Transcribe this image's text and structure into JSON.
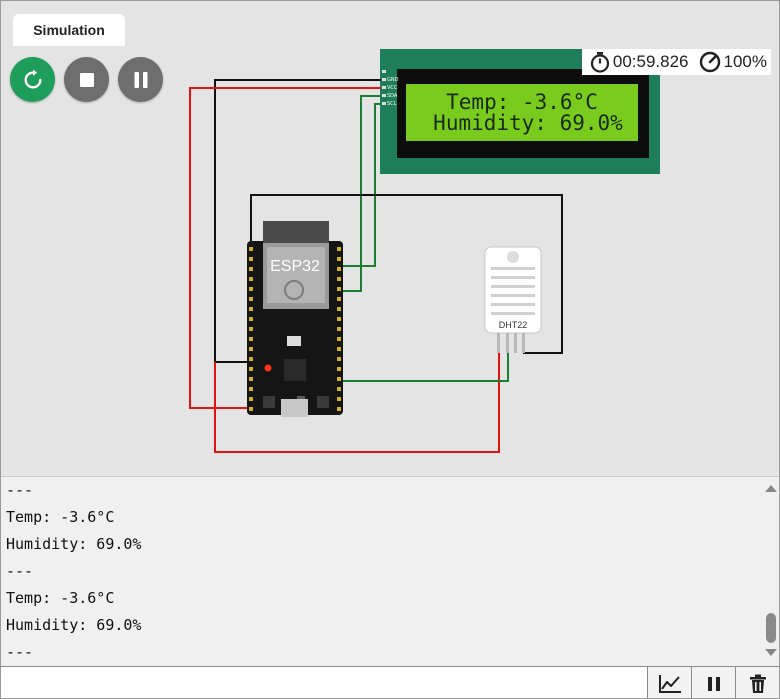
{
  "tab": {
    "label": "Simulation"
  },
  "controls": {
    "restart": {
      "icon": "restart-icon"
    },
    "stop": {
      "icon": "stop-icon"
    },
    "pause": {
      "icon": "pause-icon"
    }
  },
  "status": {
    "timer": "00:59.826",
    "speed": "100%"
  },
  "lcd": {
    "line1": "Temp: -3.6°C",
    "line2": "Humidity: 69.0%",
    "pins": [
      "GND",
      "VCC",
      "SDA",
      "SCL"
    ]
  },
  "esp32": {
    "label": "ESP32"
  },
  "dht22": {
    "label": "DHT22"
  },
  "wire_colors": {
    "black": "#111111",
    "red": "#e3140f",
    "green": "#1a7f2e"
  },
  "serial": {
    "lines": [
      "---",
      "Temp: -3.6°C",
      "Humidity: 69.0%",
      "---",
      "Temp: -3.6°C",
      "Humidity: 69.0%",
      "---"
    ]
  },
  "input": {
    "placeholder": ""
  },
  "bottom_buttons": {
    "plot": "chart-icon",
    "pause": "pause-icon",
    "clear": "trash-icon"
  },
  "colors": {
    "accent": "#1e9e5a",
    "lcd_bg": "#79cc1d",
    "board": "#1e7d5a"
  }
}
